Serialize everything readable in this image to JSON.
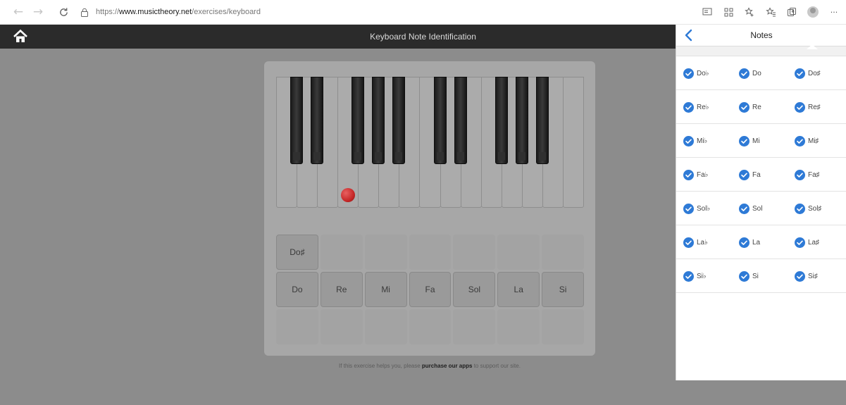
{
  "browser": {
    "url_prefix": "https://",
    "url_host": "www.musictheory.net",
    "url_path": "/exercises/keyboard",
    "icons": [
      "back-arrow-icon",
      "forward-arrow-icon",
      "reload-icon",
      "lock-icon",
      "reader-mode-icon",
      "grid-icon",
      "add-favorite-icon",
      "favorites-icon",
      "collections-icon",
      "profile-icon",
      "more-icon"
    ],
    "more_label": "···"
  },
  "header": {
    "title": "Keyboard Note Identification",
    "more_label": "•••"
  },
  "keyboard": {
    "white_keys": 15,
    "black_key_positions_after_white": [
      1,
      2,
      4,
      5,
      6,
      8,
      9,
      11,
      12,
      13
    ],
    "marked_white_key_index": 3,
    "marker_color": "#c62828"
  },
  "answers": {
    "accidental_row": [
      "Do♯",
      "",
      "",
      "",
      "",
      "",
      ""
    ],
    "natural_row": [
      "Do",
      "Re",
      "Mi",
      "Fa",
      "Sol",
      "La",
      "Si"
    ],
    "flat_row": [
      "",
      "",
      "",
      "",
      "",
      "",
      ""
    ]
  },
  "footer": {
    "text_before": "If this exercise helps you, please ",
    "link": "purchase our apps",
    "text_after": " to support our site."
  },
  "notes_panel": {
    "title": "Notes",
    "check_color": "#2e7ad6",
    "rows": [
      [
        "Do♭",
        "Do",
        "Do♯"
      ],
      [
        "Re♭",
        "Re",
        "Re♯"
      ],
      [
        "Mi♭",
        "Mi",
        "Mi♯"
      ],
      [
        "Fa♭",
        "Fa",
        "Fa♯"
      ],
      [
        "Sol♭",
        "Sol",
        "Sol♯"
      ],
      [
        "La♭",
        "La",
        "La♯"
      ],
      [
        "Si♭",
        "Si",
        "Si♯"
      ]
    ]
  }
}
